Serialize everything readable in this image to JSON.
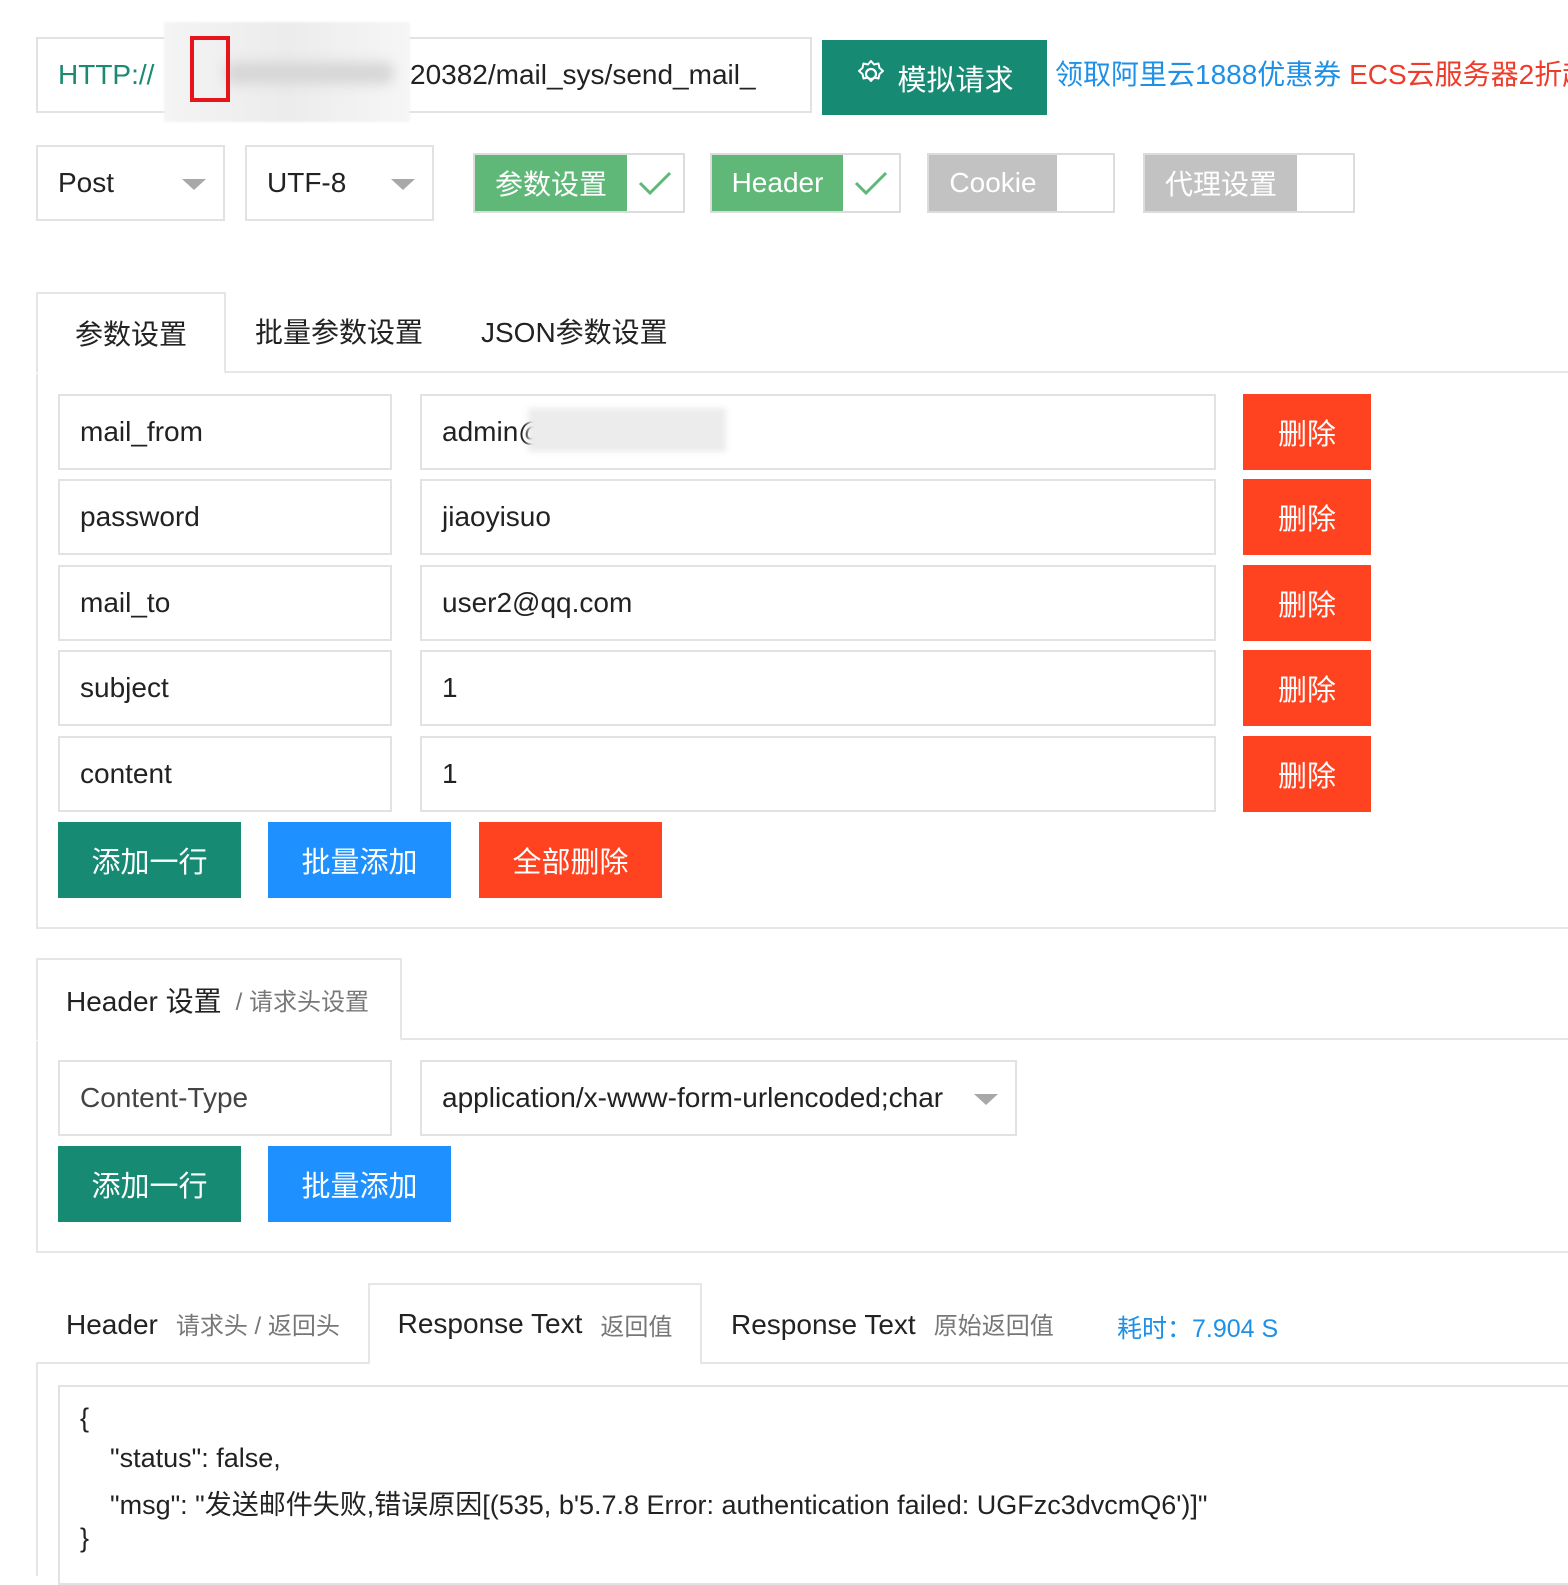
{
  "url_bar": {
    "prefix": "HTTP://",
    "url_visible": "20382/mail_sys/send_mail_",
    "simulate_label": "模拟请求",
    "promo_blue": "领取阿里云1888优惠券",
    "promo_red": "ECS云服务器2折",
    "promo_cut": "起"
  },
  "options": {
    "method": "Post",
    "charset": "UTF-8",
    "toggles": [
      {
        "label": "参数设置",
        "checked": true
      },
      {
        "label": "Header",
        "checked": true
      },
      {
        "label": "Cookie",
        "checked": false
      },
      {
        "label": "代理设置",
        "checked": false
      }
    ]
  },
  "params": {
    "tabs": [
      "参数设置",
      "批量参数设置",
      "JSON参数设置"
    ],
    "rows": [
      {
        "key": "mail_from",
        "value": "admin@"
      },
      {
        "key": "password",
        "value": "jiaoyisuo"
      },
      {
        "key": "mail_to",
        "value": "user2@qq.com"
      },
      {
        "key": "subject",
        "value": "1"
      },
      {
        "key": "content",
        "value": "1"
      }
    ],
    "delete_label": "删除",
    "add_row_label": "添加一行",
    "batch_add_label": "批量添加",
    "delete_all_label": "全部删除"
  },
  "headers": {
    "tab_title": "Header 设置",
    "tab_subtitle": "/ 请求头设置",
    "key": "Content-Type",
    "value": "application/x-www-form-urlencoded;char",
    "add_row_label": "添加一行",
    "batch_add_label": "批量添加"
  },
  "response": {
    "tabs": [
      {
        "title": "Header",
        "subtitle": "请求头 / 返回头"
      },
      {
        "title": "Response Text",
        "subtitle": "返回值"
      },
      {
        "title": "Response Text",
        "subtitle": "原始返回值"
      }
    ],
    "elapsed": "耗时：7.904 S",
    "lines": [
      "{",
      "    \"status\": false,",
      "    \"msg\": \"发送邮件失败,错误原因[(535, b'5.7.8 Error: authentication failed: UGFzc3dvcmQ6')]\"",
      "}"
    ]
  },
  "colors": {
    "primary_green": "#168a73",
    "toggle_green": "#5fb878",
    "blue": "#1e90ff",
    "danger": "#ff4321",
    "disabled": "#c2c2c2"
  }
}
